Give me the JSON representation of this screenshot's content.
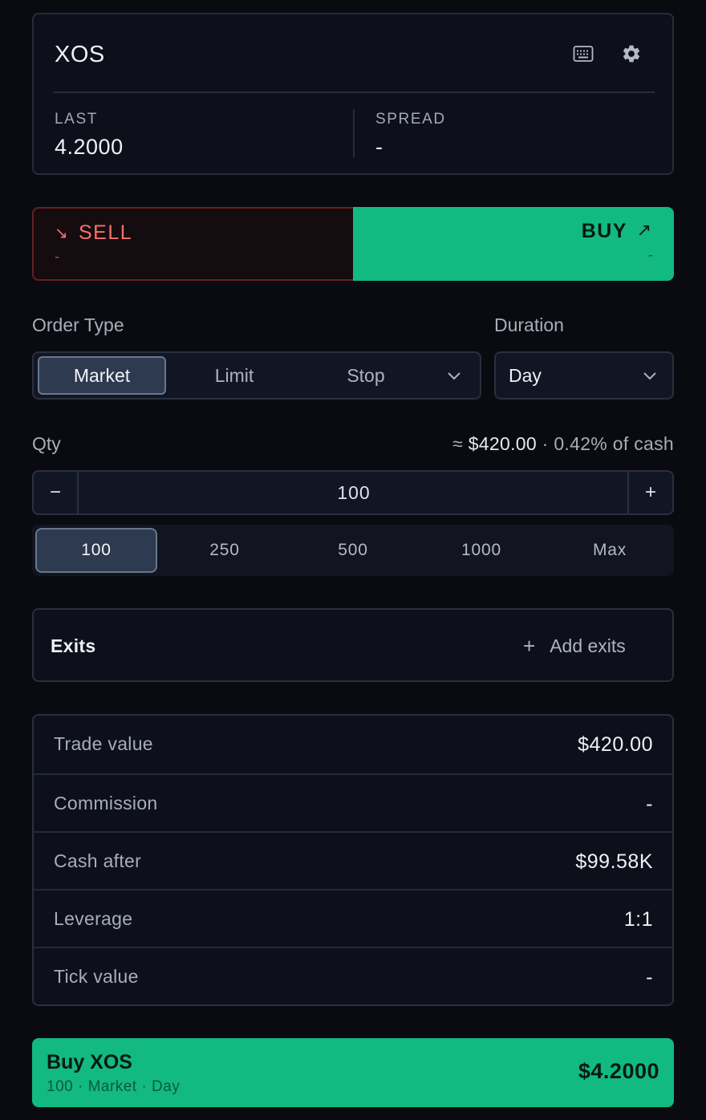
{
  "header": {
    "symbol": "XOS",
    "last_label": "LAST",
    "last_value": "4.2000",
    "spread_label": "SPREAD",
    "spread_value": "-"
  },
  "sides": {
    "sell_label": "SELL",
    "sell_sub": "-",
    "buy_label": "BUY",
    "buy_sub": "-",
    "selected": "BUY"
  },
  "order_type": {
    "label": "Order Type",
    "options": [
      "Market",
      "Limit",
      "Stop"
    ],
    "selected": "Market"
  },
  "duration": {
    "label": "Duration",
    "value": "Day"
  },
  "qty": {
    "label": "Qty",
    "approx_symbol": "≈",
    "approx_value": "$420.00",
    "separator": "·",
    "pct_of_cash": "0.42% of cash",
    "value": "100",
    "minus": "−",
    "plus": "+",
    "presets": [
      "100",
      "250",
      "500",
      "1000",
      "Max"
    ],
    "selected_preset": "100"
  },
  "exits": {
    "label": "Exits",
    "add_label": "Add exits"
  },
  "summary": {
    "rows": [
      {
        "label": "Trade value",
        "value": "$420.00"
      },
      {
        "label": "Commission",
        "value": "-"
      },
      {
        "label": "Cash after",
        "value": "$99.58K"
      },
      {
        "label": "Leverage",
        "value": "1:1"
      },
      {
        "label": "Tick value",
        "value": "-"
      }
    ]
  },
  "submit": {
    "title": "Buy XOS",
    "subtitle": "100 · Market · Day",
    "price": "$4.2000"
  },
  "colors": {
    "background": "#090b11",
    "buy_green": "#12b981",
    "sell_red": "#ff6e6e",
    "panel_border": "#2a2f3d"
  },
  "icons": {
    "keyboard": "keyboard-icon",
    "settings": "gear-icon",
    "sell_arrow": "arrow-down-right-icon",
    "buy_arrow": "arrow-up-right-icon",
    "chevron": "chevron-down-icon",
    "add": "plus-icon"
  }
}
